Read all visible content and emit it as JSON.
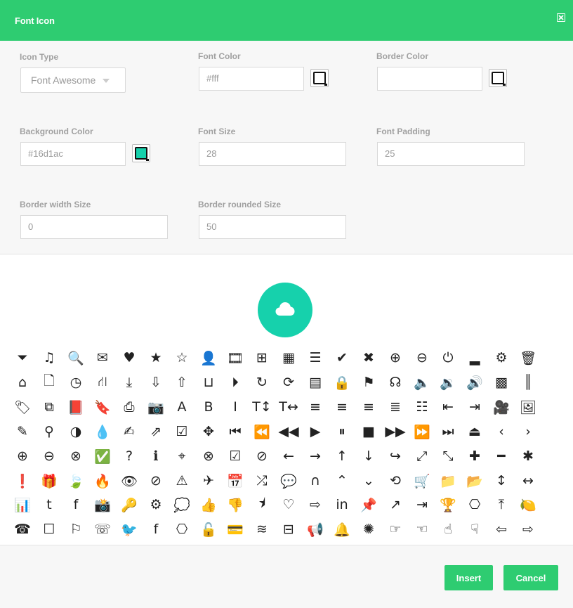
{
  "header": {
    "title": "Font Icon"
  },
  "form": {
    "icon_type": {
      "label": "Icon Type",
      "value": "Font Awesome"
    },
    "font_color": {
      "label": "Font Color",
      "value": "#fff"
    },
    "border_color": {
      "label": "Border Color",
      "value": ""
    },
    "background_color": {
      "label": "Background Color",
      "value": "#16d1ac"
    },
    "font_size": {
      "label": "Font Size",
      "value": "28"
    },
    "font_padding": {
      "label": "Font Padding",
      "value": "25"
    },
    "border_width": {
      "label": "Border width Size",
      "value": "0"
    },
    "border_rounded": {
      "label": "Border rounded Size",
      "value": "50"
    }
  },
  "colors": {
    "accent": "#2ecc71",
    "preview_bg": "#16d1ac",
    "swatch_bg": "#16d1ac"
  },
  "preview": {
    "icon": "cloud-icon"
  },
  "icons": [
    [
      "filter",
      "music",
      "search",
      "envelope",
      "heart",
      "star",
      "star-o",
      "user",
      "film",
      "th-large",
      "th",
      "th-list",
      "check",
      "times",
      "search-plus",
      "search-minus",
      "power-off",
      "signal",
      "cog",
      "trash"
    ],
    [
      "home",
      "file-o",
      "clock",
      "road",
      "download",
      "arrow-circle-down",
      "arrow-circle-up",
      "inbox",
      "play-circle",
      "repeat",
      "refresh",
      "list-alt",
      "lock",
      "flag",
      "headphones",
      "volume-off",
      "volume-down",
      "volume-up",
      "qrcode",
      "barcode"
    ],
    [
      "tag",
      "tags",
      "book",
      "bookmark",
      "print",
      "camera",
      "font",
      "bold",
      "italic",
      "text-height",
      "text-width",
      "align-left",
      "align-center",
      "align-right",
      "align-justify",
      "list",
      "outdent",
      "indent",
      "video-camera",
      "picture"
    ],
    [
      "pencil",
      "map-marker",
      "adjust",
      "tint",
      "edit",
      "share-square",
      "check-square",
      "arrows",
      "step-backward",
      "fast-backward",
      "backward",
      "play",
      "pause",
      "stop",
      "forward",
      "fast-forward",
      "step-forward",
      "eject",
      "chevron-left",
      "chevron-right"
    ],
    [
      "plus-circle",
      "minus-circle",
      "times-circle",
      "check-circle",
      "question-circle",
      "info-circle",
      "crosshairs",
      "times-circle-o",
      "check-circle-o",
      "ban",
      "arrow-left",
      "arrow-right",
      "arrow-up",
      "arrow-down",
      "share",
      "expand",
      "compress",
      "plus",
      "minus",
      "asterisk"
    ],
    [
      "exclamation-circle",
      "gift",
      "leaf",
      "fire",
      "eye",
      "eye-slash",
      "warning",
      "plane",
      "calendar",
      "random",
      "comment",
      "magnet",
      "chevron-up",
      "chevron-down",
      "retweet",
      "shopping-cart",
      "folder",
      "folder-open",
      "arrows-v",
      "arrows-h"
    ],
    [
      "bar-chart",
      "twitter-square",
      "facebook-square",
      "camera-retro",
      "key",
      "cogs",
      "comments",
      "thumbs-up",
      "thumbs-down",
      "star-half",
      "heart-o",
      "sign-out",
      "linkedin-square",
      "thumb-tack",
      "external-link",
      "sign-in",
      "trophy",
      "github-square",
      "upload",
      "lemon"
    ],
    [
      "phone",
      "square-o",
      "bookmark-o",
      "phone-square",
      "twitter",
      "facebook",
      "github",
      "unlock",
      "credit-card",
      "rss",
      "hdd",
      "bullhorn",
      "bell",
      "certificate",
      "hand-right",
      "hand-left",
      "hand-up",
      "hand-down",
      "arrow-circle-left",
      "arrow-circle-right"
    ]
  ],
  "actions": {
    "insert": "Insert",
    "cancel": "Cancel"
  }
}
